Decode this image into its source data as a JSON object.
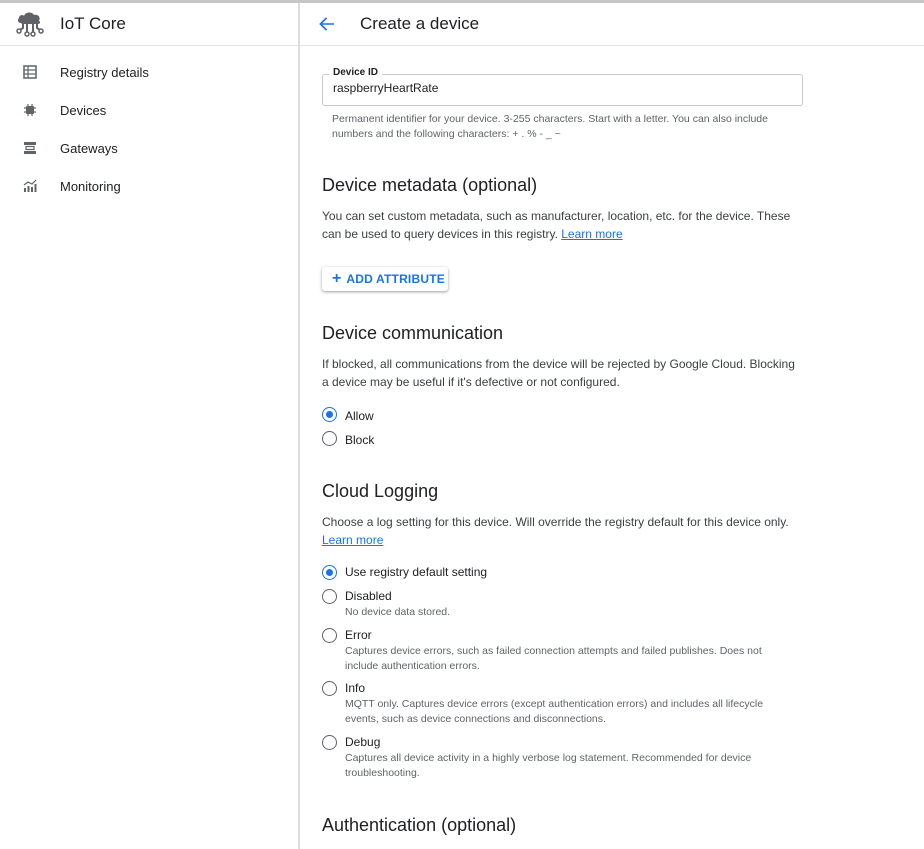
{
  "sidebar": {
    "product_icon": "iot-cloud-icon",
    "title": "IoT Core",
    "items": [
      {
        "label": "Registry details",
        "icon": "registry-details-icon"
      },
      {
        "label": "Devices",
        "icon": "devices-chip-icon"
      },
      {
        "label": "Gateways",
        "icon": "gateways-icon"
      },
      {
        "label": "Monitoring",
        "icon": "monitoring-chart-icon"
      }
    ]
  },
  "header": {
    "back_icon": "arrow-back-icon",
    "title": "Create a device"
  },
  "device_id": {
    "label": "Device ID",
    "value": "raspberryHeartRate",
    "help": "Permanent identifier for your device. 3-255 characters. Start with a letter. You can also include numbers and the following characters: + . % - _ ~"
  },
  "metadata": {
    "title": "Device metadata (optional)",
    "description": "You can set custom metadata, such as manufacturer, location, etc. for the device. These can be used to query devices in this registry.",
    "learn_more": "Learn more",
    "add_button": "ADD ATTRIBUTE"
  },
  "communication": {
    "title": "Device communication",
    "description": "If blocked, all communications from the device will be rejected by Google Cloud. Blocking a device may be useful if it's defective or not configured.",
    "options": [
      {
        "label": "Allow",
        "checked": true
      },
      {
        "label": "Block",
        "checked": false
      }
    ]
  },
  "logging": {
    "title": "Cloud Logging",
    "description": "Choose a log setting for this device. Will override the registry default for this device only.",
    "learn_more": "Learn more",
    "options": [
      {
        "label": "Use registry default setting",
        "desc": "",
        "checked": true
      },
      {
        "label": "Disabled",
        "desc": "No device data stored.",
        "checked": false
      },
      {
        "label": "Error",
        "desc": "Captures device errors, such as failed connection attempts and failed publishes. Does not include authentication errors.",
        "checked": false
      },
      {
        "label": "Info",
        "desc": "MQTT only. Captures device errors (except authentication errors) and includes all lifecycle events, such as device connections and disconnections.",
        "checked": false
      },
      {
        "label": "Debug",
        "desc": "Captures all device activity in a highly verbose log statement. Recommended for device troubleshooting.",
        "checked": false
      }
    ]
  },
  "authentication": {
    "title": "Authentication (optional)"
  },
  "colors": {
    "accent": "#1a73e8",
    "text": "#202124",
    "secondary_text": "#5f6368"
  }
}
